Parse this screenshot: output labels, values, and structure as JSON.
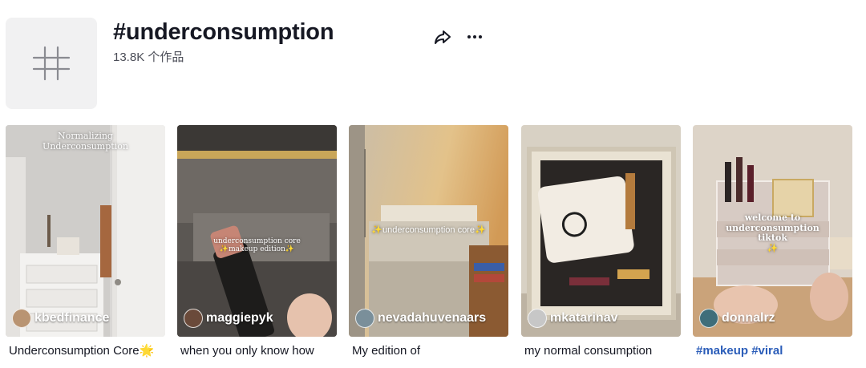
{
  "header": {
    "title": "#underconsumption",
    "count": "13.8K 个作品",
    "share_icon": "share-arrow-icon",
    "more_icon": "ellipsis-icon"
  },
  "videos": [
    {
      "overlay": "Normalizing\nUnderconsumption",
      "creator": "kbedfinance",
      "caption": "Underconsumption Core🌟",
      "avatar_color": "#b99472"
    },
    {
      "overlay": "underconsumption core\n✨makeup edition✨",
      "creator": "maggiepyk",
      "caption": "when you only know how",
      "avatar_color": "#6a4a3a"
    },
    {
      "overlay": "✨underconsumption core✨",
      "creator": "nevadahuvenaars",
      "caption": "My edition of",
      "avatar_color": "#7a8f9a"
    },
    {
      "overlay": "",
      "creator": "mkatarinav",
      "caption": "my normal consumption",
      "avatar_color": "#c7c7c7"
    },
    {
      "overlay": "welcome to\nunderconsumption\ntiktok\n✨",
      "creator": "donnalrz",
      "caption": "#makeup #viral",
      "avatar_color": "#3f6e7a"
    }
  ],
  "colors": {
    "text_primary": "#161823",
    "text_secondary": "#4b4d57",
    "hashtag_link": "#2b5db9",
    "avatar_bg": "#f1f1f2"
  }
}
